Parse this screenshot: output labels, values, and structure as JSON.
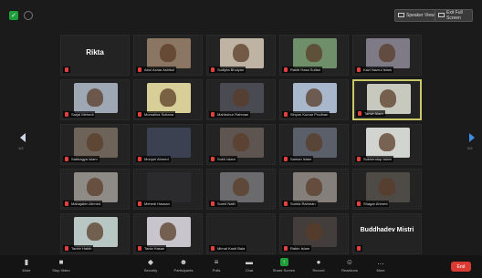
{
  "topbar": {
    "speaker_view": "Speaker View",
    "exit_full_screen": "Exit Full Screen"
  },
  "page_indicator_left": "1/2",
  "page_indicator_right": "2/2",
  "participants": [
    {
      "name": "Rikta",
      "type": "name",
      "color": "#232323"
    },
    {
      "name": "Abul Ashar Ashikul",
      "type": "video",
      "color": "#8a7662"
    },
    {
      "name": "Sudipta Bhuiyan",
      "type": "video",
      "color": "#bfb3a3"
    },
    {
      "name": "Rakib Hasa Sultan",
      "type": "video",
      "color": "#6f8f6b"
    },
    {
      "name": "Kazi Nazrul Islam",
      "type": "video",
      "color": "#7e7a86"
    },
    {
      "name": "Sarjal Mehedi",
      "type": "video",
      "color": "#9ea7b4"
    },
    {
      "name": "Morsalina Sultana",
      "type": "video",
      "color": "#d8cf98"
    },
    {
      "name": "Mahbubur Rahman",
      "type": "video",
      "color": "#4a4a52"
    },
    {
      "name": "Sinyon Kumar Prodhan",
      "type": "video",
      "color": "#a9b7cc"
    },
    {
      "name": "Tanvir Alam",
      "type": "video",
      "color": "#c7c9bf",
      "active": true
    },
    {
      "name": "Sabbagya Islam",
      "type": "video",
      "color": "#6d6358"
    },
    {
      "name": "Monjuri Ahmed",
      "type": "video",
      "color": "#3b4150",
      "nohead": true
    },
    {
      "name": "Sukh Islam",
      "type": "video",
      "color": "#5f5550"
    },
    {
      "name": "Saman Islam",
      "type": "video",
      "color": "#5a5f69"
    },
    {
      "name": "Sukhendup Islam",
      "type": "video",
      "color": "#d1d4cf"
    },
    {
      "name": "Mahajabin Ahmed",
      "type": "video",
      "color": "#8e8a86"
    },
    {
      "name": "Mehedi Hassan",
      "type": "video",
      "color": "#2b2a2c",
      "nohead": true
    },
    {
      "name": "Sumit Nath",
      "type": "video",
      "color": "#6b6b6e"
    },
    {
      "name": "Sumia Rahman",
      "type": "video",
      "color": "#857f7c"
    },
    {
      "name": "Shagar Ahmed",
      "type": "video",
      "color": "#4e4a46"
    },
    {
      "name": "Tanbir Habib",
      "type": "video",
      "color": "#b9c7c4"
    },
    {
      "name": "Tania Hasan",
      "type": "video",
      "color": "#c8c6cc"
    },
    {
      "name": "Mirnal Kanti Bala",
      "type": "name",
      "color": "#232323"
    },
    {
      "name": "Rabin Islam",
      "type": "video",
      "color": "#433e3c"
    },
    {
      "name": "Buddhadev Mistri",
      "type": "name",
      "color": "#232323"
    }
  ],
  "toolbar": [
    {
      "label": "Mute",
      "icon": "microphone-icon",
      "glyph": "▮"
    },
    {
      "label": "Stop Video",
      "icon": "video-camera-icon",
      "glyph": "■"
    },
    {
      "label": "Security",
      "icon": "shield-icon",
      "glyph": "◆"
    },
    {
      "label": "Participants",
      "icon": "participants-icon",
      "glyph": "☻"
    },
    {
      "label": "Polls",
      "icon": "polls-icon",
      "glyph": "≡"
    },
    {
      "label": "Chat",
      "icon": "chat-icon",
      "glyph": "▬"
    },
    {
      "label": "Share Screen",
      "icon": "share-screen-icon",
      "glyph": "↑"
    },
    {
      "label": "Record",
      "icon": "record-icon",
      "glyph": "●"
    },
    {
      "label": "Reactions",
      "icon": "reactions-icon",
      "glyph": "☺"
    },
    {
      "label": "More",
      "icon": "more-icon",
      "glyph": "…"
    }
  ],
  "end_button": "End",
  "colors": {
    "active_border": "#c9c96a",
    "share_green": "#1f9e3a",
    "end_red": "#d93a32",
    "next_arrow": "#3b8ee8"
  }
}
